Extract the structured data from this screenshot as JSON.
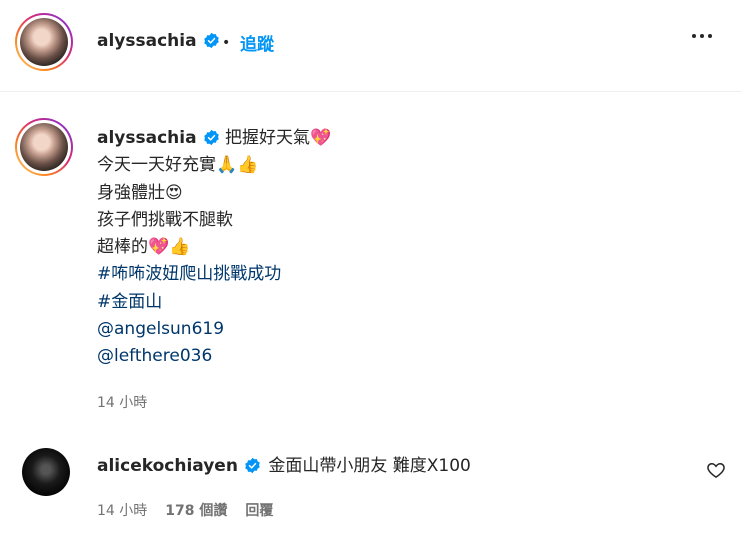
{
  "header": {
    "username": "alyssachia",
    "separator": "•",
    "follow_label": "追蹤"
  },
  "post": {
    "username": "alyssachia",
    "caption_lines": [
      "把握好天氣💖",
      "今天一天好充實🙏👍",
      "身強體壯😍",
      "孩子們挑戰不腿軟",
      "超棒的💖👍"
    ],
    "hashtags": [
      "#咘咘波妞爬山挑戰成功",
      "#金面山"
    ],
    "mentions": [
      "@angelsun619",
      "@lefthere036"
    ],
    "time": "14 小時"
  },
  "comment": {
    "username": "alicekochiayen",
    "text": "金面山帶小朋友 難度X100",
    "time": "14 小時",
    "likes": "178 個讚",
    "reply_label": "回覆"
  },
  "colors": {
    "link": "#00376b",
    "follow": "#0095f6",
    "verified": "#0095f6",
    "meta": "#737373"
  },
  "icons": [
    "verified-badge-icon",
    "more-options-icon",
    "heart-icon"
  ]
}
